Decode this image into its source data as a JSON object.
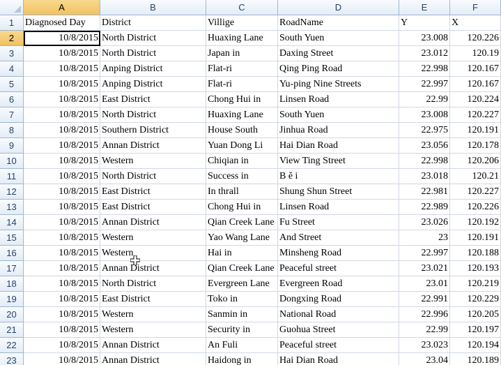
{
  "columns": [
    "A",
    "B",
    "C",
    "D",
    "E",
    "F"
  ],
  "headers": [
    "Diagnosed Day",
    "District",
    "Villige",
    "RoadName",
    "Y",
    "X"
  ],
  "rows": [
    [
      "10/8/2015",
      "North District",
      "Huaxing Lane",
      "South Yuen",
      "23.008",
      "120.226"
    ],
    [
      "10/8/2015",
      "North District",
      "Japan in",
      "Daxing Street",
      "23.012",
      "120.19"
    ],
    [
      "10/8/2015",
      "Anping District",
      "Flat-ri",
      "Qing Ping Road",
      "22.998",
      "120.167"
    ],
    [
      "10/8/2015",
      "Anping District",
      "Flat-ri",
      "Yu-ping Nine Streets",
      "22.997",
      "120.167"
    ],
    [
      "10/8/2015",
      "East District",
      "Chong Hui in",
      "Linsen Road",
      "22.99",
      "120.224"
    ],
    [
      "10/8/2015",
      "North District",
      "Huaxing Lane",
      "South Yuen",
      "23.008",
      "120.227"
    ],
    [
      "10/8/2015",
      "Southern District",
      "House South",
      "Jinhua Road",
      "22.975",
      "120.191"
    ],
    [
      "10/8/2015",
      "Annan District",
      "Yuan Dong Li",
      "Hai Dian Road",
      "23.056",
      "120.178"
    ],
    [
      "10/8/2015",
      "Western",
      "Chiqian in",
      "View Ting Street",
      "22.998",
      "120.206"
    ],
    [
      "10/8/2015",
      "North District",
      "Success in",
      "B ě i",
      "23.018",
      "120.21"
    ],
    [
      "10/8/2015",
      "East District",
      "In thrall",
      "Shung Shun Street",
      "22.981",
      "120.227"
    ],
    [
      "10/8/2015",
      "East District",
      "Chong Hui in",
      "Linsen Road",
      "22.989",
      "120.226"
    ],
    [
      "10/8/2015",
      "Annan District",
      "Qian Creek Lane",
      "Fu Street",
      "23.026",
      "120.192"
    ],
    [
      "10/8/2015",
      "Western",
      "Yao Wang Lane",
      "And Street",
      "23",
      "120.191"
    ],
    [
      "10/8/2015",
      "Western",
      "Hai in",
      "Minsheng Road",
      "22.997",
      "120.188"
    ],
    [
      "10/8/2015",
      "Annan District",
      "Qian Creek Lane",
      "Peaceful street",
      "23.021",
      "120.193"
    ],
    [
      "10/8/2015",
      "North District",
      "Evergreen Lane",
      "Evergreen Road",
      "23.01",
      "120.219"
    ],
    [
      "10/8/2015",
      "East District",
      "Toko in",
      "Dongxing Road",
      "22.991",
      "120.229"
    ],
    [
      "10/8/2015",
      "Western",
      "Sanmin in",
      "National Road",
      "22.996",
      "120.205"
    ],
    [
      "10/8/2015",
      "Western",
      "Security in",
      "Guohua Street",
      "22.99",
      "120.197"
    ],
    [
      "10/8/2015",
      "Annan District",
      "An Fuli",
      "Peaceful street",
      "23.023",
      "120.194"
    ],
    [
      "10/8/2015",
      "Annan District",
      "Haidong in",
      "Hai Dian Road",
      "23.04",
      "120.189"
    ]
  ]
}
